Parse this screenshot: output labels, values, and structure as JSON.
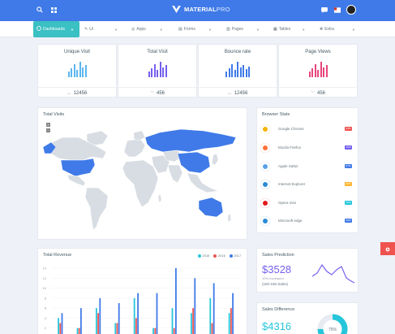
{
  "brand": {
    "name_bold": "MATERIAL",
    "name_light": "PRO"
  },
  "nav": [
    {
      "label": "Dashboards",
      "icon": "dashboard-icon"
    },
    {
      "label": "Ui",
      "icon": "puzzle-icon"
    },
    {
      "label": "Apps",
      "icon": "apps-icon"
    },
    {
      "label": "Forms",
      "icon": "document-icon"
    },
    {
      "label": "Pages",
      "icon": "pages-icon"
    },
    {
      "label": "Tables",
      "icon": "table-icon"
    },
    {
      "label": "Extra",
      "icon": "extra-icon"
    }
  ],
  "stats": [
    {
      "title": "Unique Visit",
      "value": "12456",
      "trend": "up",
      "color": "#5ab6f0",
      "bars": [
        0.35,
        0.55,
        0.8,
        0.45,
        0.95,
        0.6,
        0.75
      ]
    },
    {
      "title": "Total Visit",
      "value": "456",
      "trend": "down",
      "color": "#7460ee",
      "bars": [
        0.35,
        0.55,
        0.8,
        0.45,
        0.95,
        0.6,
        0.75
      ]
    },
    {
      "title": "Bounce rate",
      "value": "12456",
      "trend": "up",
      "color": "#3f7ae8",
      "bars": [
        0.35,
        0.55,
        0.8,
        0.45,
        0.95,
        0.6,
        0.75,
        0.5,
        0.65
      ]
    },
    {
      "title": "Page Views",
      "value": "456",
      "trend": "down",
      "color": "#e8457c",
      "bars": [
        0.35,
        0.55,
        0.8,
        0.45,
        0.95,
        0.6,
        0.75
      ]
    }
  ],
  "total_visits": {
    "title": "Total Visits"
  },
  "browser_stats": {
    "title": "Browser Stats",
    "items": [
      {
        "name": "Google Chrome",
        "badge": "23%",
        "badge_color": "#ef5350",
        "icon_color": "#f4b400"
      },
      {
        "name": "Mozila Firefox",
        "badge": "15%",
        "badge_color": "#7460ee",
        "icon_color": "#ff7139"
      },
      {
        "name": "Apple Safari",
        "badge": "07%",
        "badge_color": "#3f7ae8",
        "icon_color": "#5aa0e8"
      },
      {
        "name": "Internet Explorer",
        "badge": "09%",
        "badge_color": "#ffb22b",
        "icon_color": "#2a8ad6"
      },
      {
        "name": "Opera mini",
        "badge": "23%",
        "badge_color": "#26c6da",
        "icon_color": "#e0181d"
      },
      {
        "name": "Microsoft edge",
        "badge": "09%",
        "badge_color": "#3f7ae8",
        "icon_color": "#2a8ad6"
      }
    ]
  },
  "total_revenue": {
    "title": "Total Revenue",
    "legend": [
      {
        "name": "2015",
        "color": "#26c6da"
      },
      {
        "name": "2016",
        "color": "#ef5350"
      },
      {
        "name": "2017",
        "color": "#3f7ae8"
      }
    ]
  },
  "chart_data": {
    "type": "bar",
    "y_ticks": [
      0,
      2,
      4,
      6,
      8,
      10,
      12,
      14
    ],
    "ylim": [
      0,
      14
    ],
    "series": [
      {
        "name": "2015",
        "values": [
          4,
          2,
          6,
          3,
          8,
          2,
          6,
          5,
          8,
          5
        ]
      },
      {
        "name": "2016",
        "values": [
          3,
          2,
          5,
          3,
          4,
          2,
          2,
          6,
          3,
          6
        ]
      },
      {
        "name": "2017",
        "values": [
          5,
          6,
          8,
          7,
          9,
          9,
          14,
          12,
          11,
          9
        ]
      }
    ]
  },
  "sales_prediction": {
    "title": "Sales Prediction",
    "value": "$3528",
    "sub1": "10% Increased",
    "sub2": "(150-165 Sales)"
  },
  "sales_difference": {
    "title": "Sales Difference",
    "value": "$4316",
    "donut_label": "75%",
    "donut_percent": 75
  }
}
